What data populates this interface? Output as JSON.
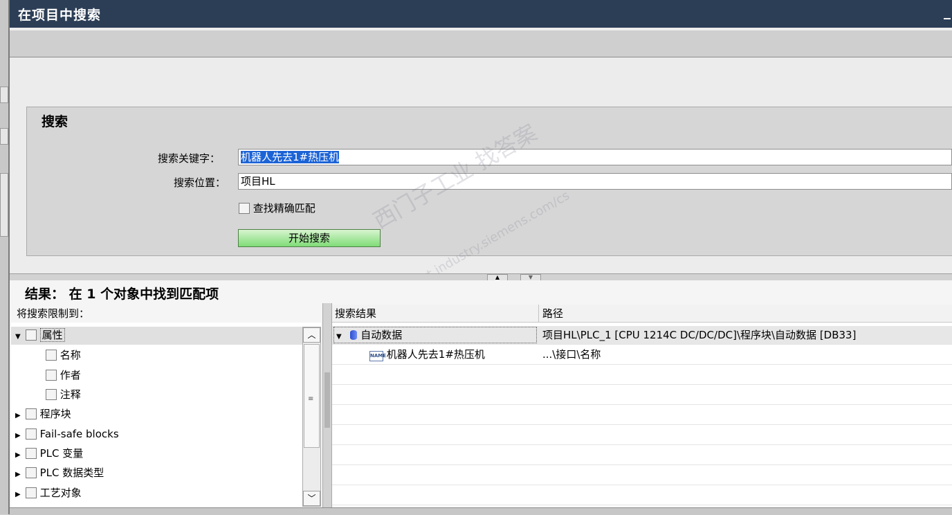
{
  "window": {
    "title": "在项目中搜索",
    "minimize_glyph": "_"
  },
  "search": {
    "heading": "搜索",
    "keyword_label": "搜索关键字：",
    "keyword_value": "机器人先去1#热压机",
    "location_label": "搜索位置：",
    "location_value": "项目HL",
    "exact_match_label": "查找精确匹配",
    "exact_match_checked": false,
    "start_button": "开始搜索"
  },
  "results": {
    "title": "结果： 在 1 个对象中找到匹配项",
    "restrict_label": "将搜索限制到：",
    "filter_tree": [
      {
        "label": "属性",
        "level": 0,
        "expanded": true
      },
      {
        "label": "名称",
        "level": 1
      },
      {
        "label": "作者",
        "level": 1
      },
      {
        "label": "注释",
        "level": 1
      },
      {
        "label": "程序块",
        "level": 0,
        "expanded": false
      },
      {
        "label": "Fail-safe blocks",
        "level": 0,
        "expanded": false
      },
      {
        "label": "PLC 变量",
        "level": 0,
        "expanded": false
      },
      {
        "label": "PLC 数据类型",
        "level": 0,
        "expanded": false
      },
      {
        "label": "工艺对象",
        "level": 0,
        "expanded": false
      }
    ],
    "columns": [
      "搜索结果",
      "路径"
    ],
    "rows": [
      {
        "result": "自动数据",
        "path": "项目HL\\PLC_1 [CPU 1214C DC/DC/DC]\\程序块\\自动数据 [DB33]",
        "icon": "database-icon"
      },
      {
        "result": "机器人先去1#热压机",
        "path": "...\\接口\\名称",
        "icon": "name-tag-icon"
      }
    ]
  },
  "watermark": {
    "line1": "西门子工业  找答案",
    "line2": "support.industry.siemens.com/cs"
  },
  "colors": {
    "title_bar": "#2c3e56",
    "selection": "#1c63d6",
    "button_green": "#7fdc76"
  }
}
